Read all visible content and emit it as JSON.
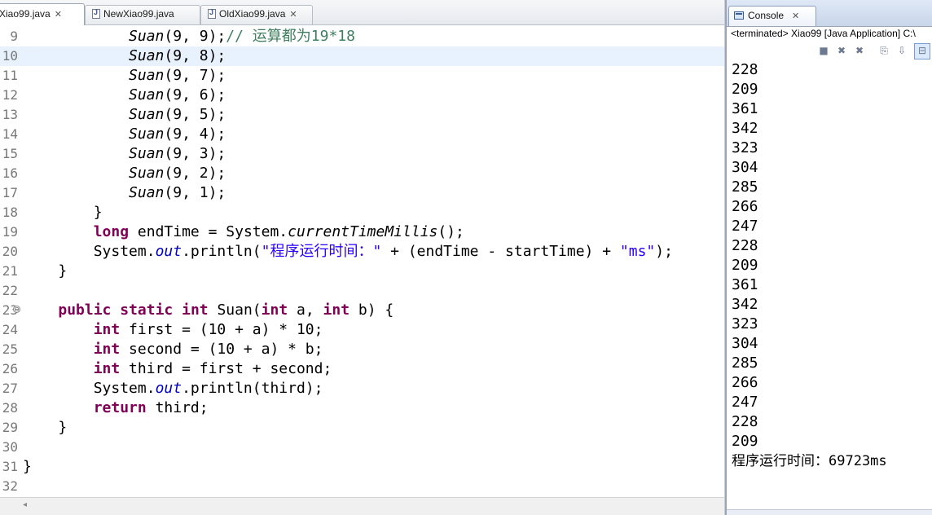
{
  "editor": {
    "tabs": [
      {
        "label": "Xiao99.java",
        "close": "✕",
        "active": true
      },
      {
        "label": "NewXiao99.java",
        "close": "",
        "active": false
      },
      {
        "label": "OldXiao99.java",
        "close": "✕",
        "active": false
      }
    ],
    "current_line": 10,
    "lines": [
      {
        "n": "9",
        "segs": [
          [
            "",
            "            "
          ],
          [
            "mi",
            "Suan"
          ],
          [
            "",
            "(9, 9);"
          ],
          [
            "cmt",
            "// 运算都为19*18"
          ]
        ]
      },
      {
        "n": "10",
        "segs": [
          [
            "",
            "            "
          ],
          [
            "mi",
            "Suan"
          ],
          [
            "",
            "(9, 8);"
          ]
        ]
      },
      {
        "n": "11",
        "segs": [
          [
            "",
            "            "
          ],
          [
            "mi",
            "Suan"
          ],
          [
            "",
            "(9, 7);"
          ]
        ]
      },
      {
        "n": "12",
        "segs": [
          [
            "",
            "            "
          ],
          [
            "mi",
            "Suan"
          ],
          [
            "",
            "(9, 6);"
          ]
        ]
      },
      {
        "n": "13",
        "segs": [
          [
            "",
            "            "
          ],
          [
            "mi",
            "Suan"
          ],
          [
            "",
            "(9, 5);"
          ]
        ]
      },
      {
        "n": "14",
        "segs": [
          [
            "",
            "            "
          ],
          [
            "mi",
            "Suan"
          ],
          [
            "",
            "(9, 4);"
          ]
        ]
      },
      {
        "n": "15",
        "segs": [
          [
            "",
            "            "
          ],
          [
            "mi",
            "Suan"
          ],
          [
            "",
            "(9, 3);"
          ]
        ]
      },
      {
        "n": "16",
        "segs": [
          [
            "",
            "            "
          ],
          [
            "mi",
            "Suan"
          ],
          [
            "",
            "(9, 2);"
          ]
        ]
      },
      {
        "n": "17",
        "segs": [
          [
            "",
            "            "
          ],
          [
            "mi",
            "Suan"
          ],
          [
            "",
            "(9, 1);"
          ]
        ]
      },
      {
        "n": "18",
        "segs": [
          [
            "",
            "        }"
          ]
        ]
      },
      {
        "n": "19",
        "segs": [
          [
            "",
            "        "
          ],
          [
            "kw",
            "long"
          ],
          [
            "",
            " endTime = System."
          ],
          [
            "mi",
            "currentTimeMillis"
          ],
          [
            "",
            "();"
          ]
        ]
      },
      {
        "n": "20",
        "segs": [
          [
            "",
            "        System."
          ],
          [
            "fld",
            "out"
          ],
          [
            "",
            ".println("
          ],
          [
            "str",
            "\"程序运行时间：\""
          ],
          [
            "",
            " + (endTime - startTime) + "
          ],
          [
            "str",
            "\"ms\""
          ],
          [
            "",
            ");"
          ]
        ]
      },
      {
        "n": "21",
        "segs": [
          [
            "",
            "    }"
          ]
        ]
      },
      {
        "n": "22",
        "segs": []
      },
      {
        "n": "23",
        "fold": "⊖",
        "segs": [
          [
            "",
            "    "
          ],
          [
            "kw",
            "public"
          ],
          [
            "",
            " "
          ],
          [
            "kw",
            "static"
          ],
          [
            "",
            " "
          ],
          [
            "kw",
            "int"
          ],
          [
            "",
            " Suan("
          ],
          [
            "kw",
            "int"
          ],
          [
            "",
            " a, "
          ],
          [
            "kw",
            "int"
          ],
          [
            "",
            " b) {"
          ]
        ]
      },
      {
        "n": "24",
        "segs": [
          [
            "",
            "        "
          ],
          [
            "kw",
            "int"
          ],
          [
            "",
            " first = (10 + a) * 10;"
          ]
        ]
      },
      {
        "n": "25",
        "segs": [
          [
            "",
            "        "
          ],
          [
            "kw",
            "int"
          ],
          [
            "",
            " second = (10 + a) * b;"
          ]
        ]
      },
      {
        "n": "26",
        "segs": [
          [
            "",
            "        "
          ],
          [
            "kw",
            "int"
          ],
          [
            "",
            " third = first + second;"
          ]
        ]
      },
      {
        "n": "27",
        "segs": [
          [
            "",
            "        System."
          ],
          [
            "fld",
            "out"
          ],
          [
            "",
            ".println(third);"
          ]
        ]
      },
      {
        "n": "28",
        "segs": [
          [
            "",
            "        "
          ],
          [
            "kw",
            "return"
          ],
          [
            "",
            " third;"
          ]
        ]
      },
      {
        "n": "29",
        "segs": [
          [
            "",
            "    }"
          ]
        ]
      },
      {
        "n": "30",
        "segs": []
      },
      {
        "n": "31",
        "segs": [
          [
            "",
            "}"
          ]
        ]
      },
      {
        "n": "32",
        "segs": []
      }
    ],
    "hscroll_arrow": "◂"
  },
  "console": {
    "tab_label": "Console",
    "tab_close": "✕",
    "status": "<terminated> Xiao99 [Java Application] C:\\",
    "toolbar": [
      {
        "name": "terminate-icon",
        "glyph": "■"
      },
      {
        "name": "remove-launch-icon",
        "glyph": "✖"
      },
      {
        "name": "remove-all-terminated-icon",
        "glyph": "✖"
      },
      {
        "name": "clear-console-icon",
        "glyph": "⎘"
      },
      {
        "name": "scroll-lock-icon",
        "glyph": "⇩"
      },
      {
        "name": "word-wrap-icon",
        "glyph": "⊟"
      }
    ],
    "output": [
      "228",
      "209",
      "361",
      "342",
      "323",
      "304",
      "285",
      "266",
      "247",
      "228",
      "209",
      "361",
      "342",
      "323",
      "304",
      "285",
      "266",
      "247",
      "228",
      "209",
      "程序运行时间：69723ms"
    ]
  }
}
